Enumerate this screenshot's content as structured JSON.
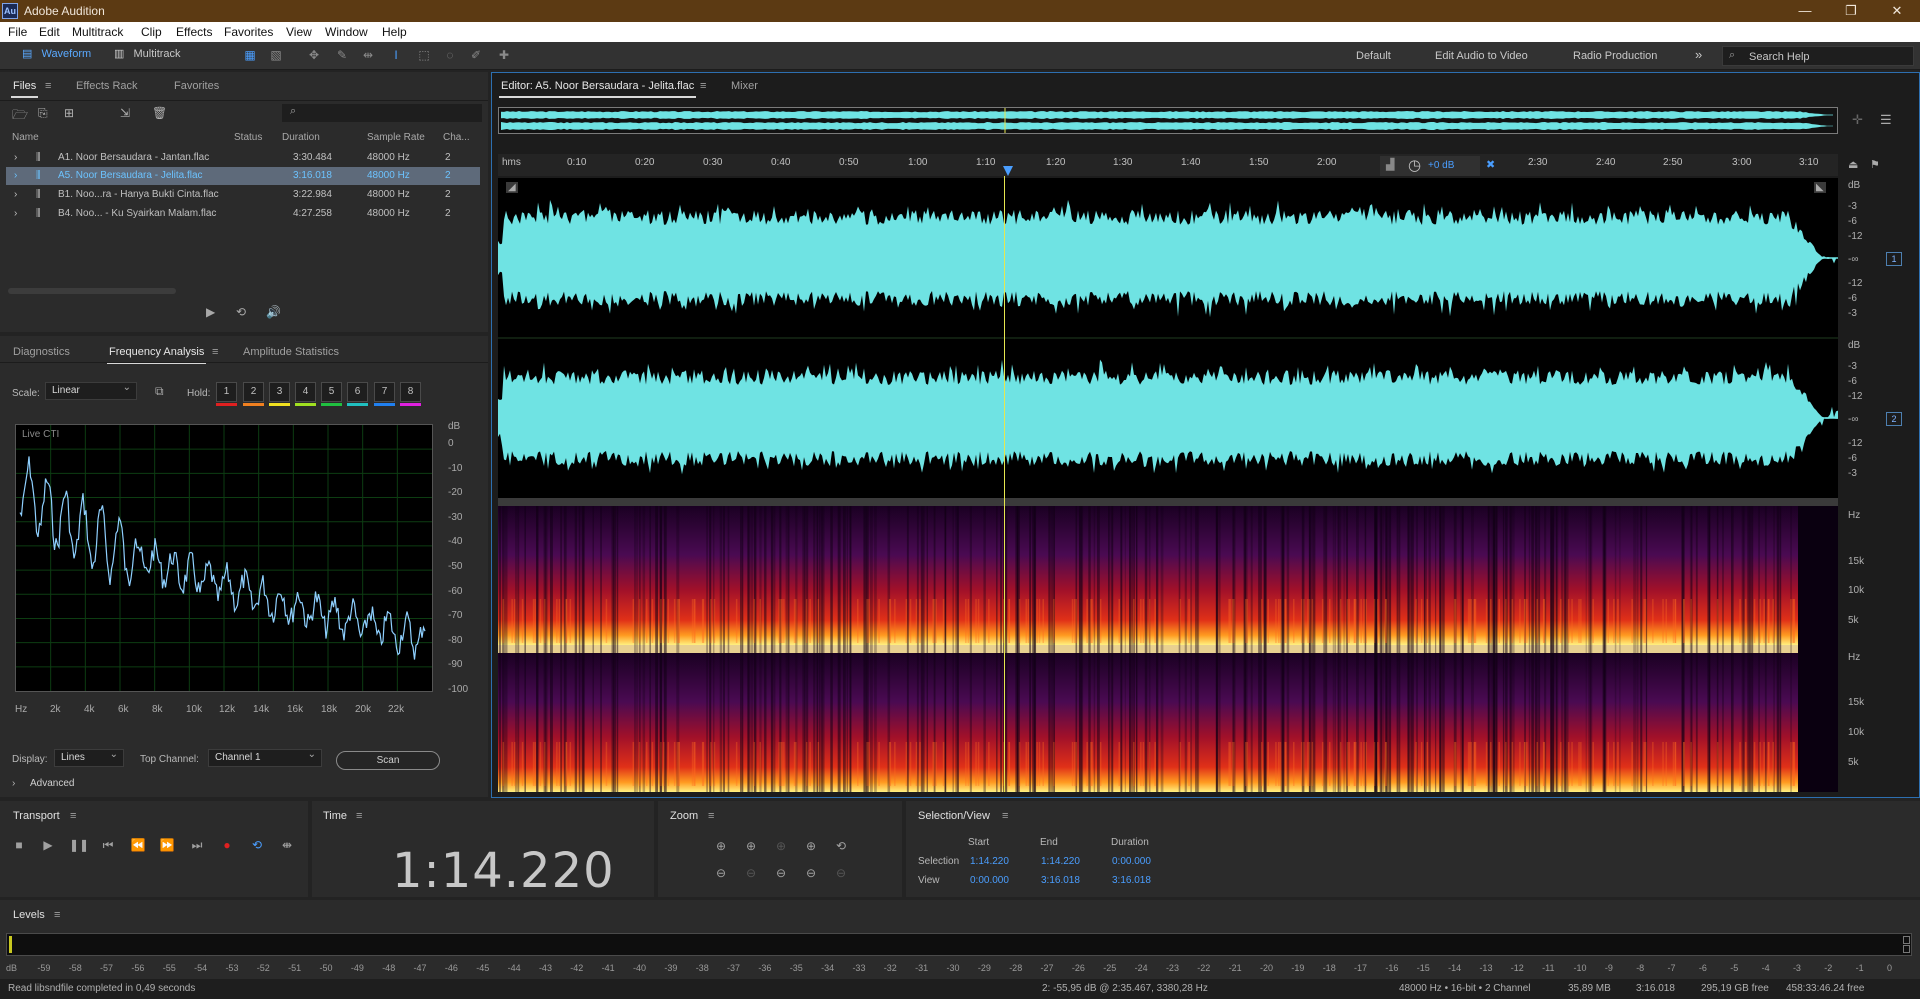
{
  "window": {
    "title": "Adobe Audition",
    "logo": "Au"
  },
  "menu": [
    "File",
    "Edit",
    "Multitrack",
    "Clip",
    "Effects",
    "Favorites",
    "View",
    "Window",
    "Help"
  ],
  "toolbar": {
    "waveform": "Waveform",
    "multitrack": "Multitrack",
    "workspaces": [
      "Default",
      "Edit Audio to Video",
      "Radio Production"
    ],
    "search_placeholder": "Search Help"
  },
  "files_panel": {
    "tabs": [
      "Files",
      "Effects Rack",
      "Favorites"
    ],
    "columns": [
      "Name",
      "Status",
      "Duration",
      "Sample Rate",
      "Cha..."
    ],
    "rows": [
      {
        "name": "A1. Noor Bersaudara - Jantan.flac",
        "duration": "3:30.484",
        "rate": "48000 Hz",
        "ch": "2"
      },
      {
        "name": "A5. Noor Bersaudara - Jelita.flac",
        "duration": "3:16.018",
        "rate": "48000 Hz",
        "ch": "2"
      },
      {
        "name": "B1. Noo...ra - Hanya Bukti Cinta.flac",
        "duration": "3:22.984",
        "rate": "48000 Hz",
        "ch": "2"
      },
      {
        "name": "B4. Noo... - Ku Syairkan Malam.flac",
        "duration": "4:27.258",
        "rate": "48000 Hz",
        "ch": "2"
      }
    ],
    "selected_index": 1
  },
  "analysis_panel": {
    "tabs": [
      "Diagnostics",
      "Frequency Analysis",
      "Amplitude Statistics"
    ],
    "scale_label": "Scale:",
    "scale_value": "Linear",
    "hold_label": "Hold:",
    "hold_buttons": [
      "1",
      "2",
      "3",
      "4",
      "5",
      "6",
      "7",
      "8"
    ],
    "hold_colors": [
      "#e02020",
      "#f08020",
      "#f0e020",
      "#a0e020",
      "#20c040",
      "#20c0c0",
      "#2080f0",
      "#e020e0"
    ],
    "live_label": "Live CTI",
    "db_unit": "dB",
    "db_ticks": [
      "0",
      "-10",
      "-20",
      "-30",
      "-40",
      "-50",
      "-60",
      "-70",
      "-80",
      "-90",
      "-100"
    ],
    "hz_ticks": [
      "Hz",
      "2k",
      "4k",
      "6k",
      "8k",
      "10k",
      "12k",
      "14k",
      "16k",
      "18k",
      "20k",
      "22k"
    ],
    "display_label": "Display:",
    "display_value": "Lines",
    "top_channel_label": "Top Channel:",
    "top_channel_value": "Channel 1",
    "scan": "Scan",
    "advanced": "Advanced"
  },
  "editor": {
    "tab": "Editor: A5. Noor Bersaudara - Jelita.flac",
    "mixer": "Mixer",
    "ruler": [
      "hms",
      "0:10",
      "0:20",
      "0:30",
      "0:40",
      "0:50",
      "1:00",
      "1:10",
      "1:20",
      "1:30",
      "1:40",
      "1:50",
      "2:00",
      "2:30",
      "2:40",
      "2:50",
      "3:00",
      "3:10"
    ],
    "gain": "+0 dB",
    "db_scale": [
      "dB",
      "-3",
      "-6",
      "-12",
      "-∞",
      "-12",
      "-6",
      "-3"
    ],
    "channels": [
      "1",
      "2"
    ],
    "hz_scale": [
      "Hz",
      "15k",
      "10k",
      "5k"
    ],
    "waveform_color": "#6fe3e3"
  },
  "transport": {
    "title": "Transport"
  },
  "time": {
    "title": "Time",
    "value": "1:14.220"
  },
  "zoom": {
    "title": "Zoom"
  },
  "selection": {
    "title": "Selection/View",
    "headers": [
      "Start",
      "End",
      "Duration"
    ],
    "selection_label": "Selection",
    "selection": [
      "1:14.220",
      "1:14.220",
      "0:00.000"
    ],
    "view_label": "View",
    "view": [
      "0:00.000",
      "3:16.018",
      "3:16.018"
    ]
  },
  "levels": {
    "title": "Levels",
    "ticks": [
      "dB",
      "-59",
      "-58",
      "-57",
      "-56",
      "-55",
      "-54",
      "-53",
      "-52",
      "-51",
      "-50",
      "-49",
      "-48",
      "-47",
      "-46",
      "-45",
      "-44",
      "-43",
      "-42",
      "-41",
      "-40",
      "-39",
      "-38",
      "-37",
      "-36",
      "-35",
      "-34",
      "-33",
      "-32",
      "-31",
      "-30",
      "-29",
      "-28",
      "-27",
      "-26",
      "-25",
      "-24",
      "-23",
      "-22",
      "-21",
      "-20",
      "-19",
      "-18",
      "-17",
      "-16",
      "-15",
      "-14",
      "-13",
      "-12",
      "-11",
      "-10",
      "-9",
      "-8",
      "-7",
      "-6",
      "-5",
      "-4",
      "-3",
      "-2",
      "-1",
      "0"
    ]
  },
  "status": {
    "left": "Read libsndfile completed in 0,49 seconds",
    "cursor": "2: -55,95 dB @ 2:35.467, 3380,28 Hz",
    "format": "48000 Hz • 16-bit • 2 Channel",
    "size": "35,89 MB",
    "duration": "3:16.018",
    "free": "295,19 GB free",
    "free_time": "458:33:46.24 free"
  }
}
